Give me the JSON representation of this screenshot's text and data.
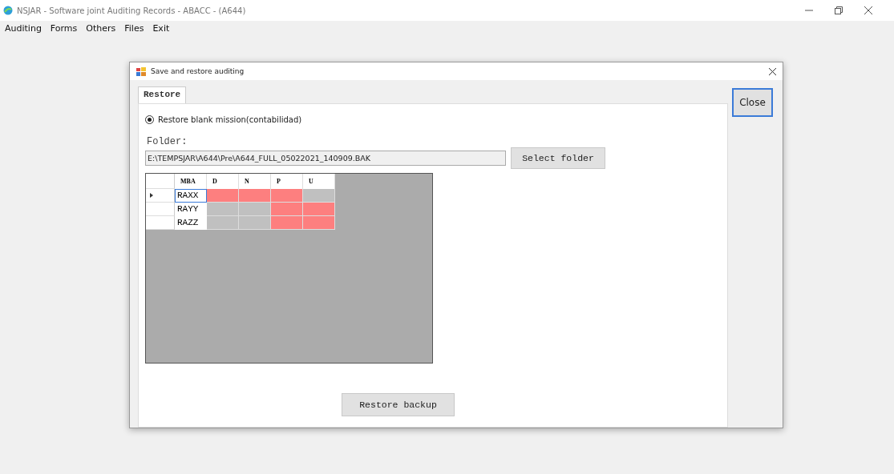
{
  "window": {
    "title": "NSJAR - Software joint Auditing Records - ABACC - (A644)"
  },
  "menu": [
    "Auditing",
    "Forms",
    "Others",
    "Files",
    "Exit"
  ],
  "dialog": {
    "title": "Save and restore auditing",
    "tabs": [
      {
        "label": "Restore",
        "selected": true
      }
    ],
    "radio": {
      "label": "Restore blank mission(contabilidad)",
      "checked": true
    },
    "folder_label": "Folder:",
    "folder_value": "E:\\TEMPSJAR\\A644\\Pre\\A644_FULL_05022021_140909.BAK",
    "select_button": "Select folder",
    "grid": {
      "columns": [
        "MBA",
        "D",
        "N",
        "P",
        "U"
      ],
      "rows": [
        {
          "selected": true,
          "name": "RAXX",
          "cells": [
            {
              "color": "#fd7f7f"
            },
            {
              "color": "#fd7f7f"
            },
            {
              "color": "#fd7f7f"
            },
            {
              "color": "#c0c0c0"
            }
          ]
        },
        {
          "selected": false,
          "name": "RAYY",
          "cells": [
            {
              "color": "#c0c0c0"
            },
            {
              "color": "#c0c0c0"
            },
            {
              "color": "#fd7f7f"
            },
            {
              "color": "#fd7f7f"
            }
          ]
        },
        {
          "selected": false,
          "name": "RAZZ",
          "cells": [
            {
              "color": "#c0c0c0"
            },
            {
              "color": "#c0c0c0"
            },
            {
              "color": "#fd7f7f"
            },
            {
              "color": "#fd7f7f"
            }
          ]
        }
      ]
    },
    "restore_button": "Restore backup",
    "close_button": "Close"
  }
}
